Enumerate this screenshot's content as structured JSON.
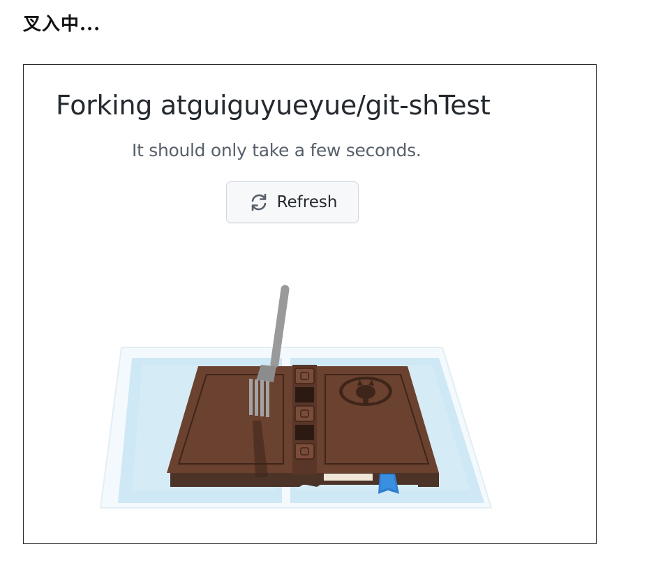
{
  "document": {
    "heading": "叉入中..."
  },
  "fork_page": {
    "title": "Forking atguiguyueyue/git-shTest",
    "subtitle": "It should only take a few seconds.",
    "refresh_button": {
      "label": "Refresh",
      "icon": "refresh-icon"
    },
    "illustration": {
      "icon": "forking-book-icon",
      "description_icon": "octocat-icon"
    }
  },
  "colors": {
    "title": "#24292f",
    "subtitle": "#57606a",
    "button_bg": "#f6f8fa",
    "button_border": "#d0d7de",
    "book_brown": "#6b4130",
    "water_blue": "#cfe8f5",
    "fork_gray": "#9a9a9a",
    "ribbon_blue": "#2f7fd1"
  }
}
